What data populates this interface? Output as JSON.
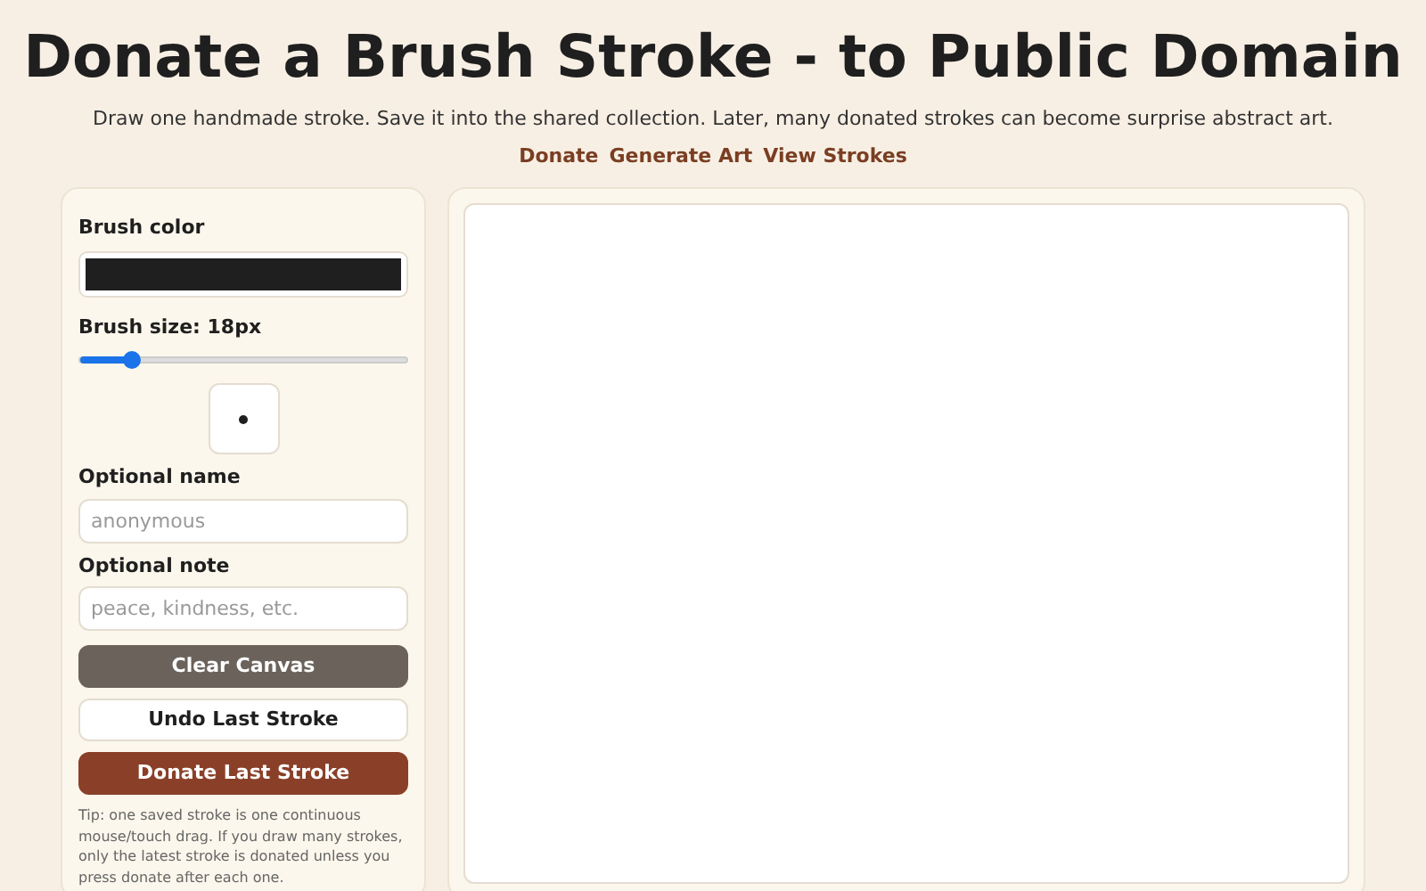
{
  "header": {
    "title": "Donate a Brush Stroke - to Public Domain",
    "subtitle": "Draw one handmade stroke. Save it into the shared collection. Later, many donated strokes can become surprise abstract art."
  },
  "nav": [
    "Donate",
    "Generate Art",
    "View Strokes"
  ],
  "controls": {
    "color_label": "Brush color",
    "color": "#1f1f1f",
    "size_label": "Brush size: 18px",
    "size": {
      "level": 0.16
    },
    "name": {
      "label": "Optional name",
      "placeholder": "anonymous"
    },
    "note": {
      "label": "Optional note",
      "placeholder": "peace, kindness, etc."
    },
    "buttons": [
      {
        "label": "Clear Canvas",
        "kind": "secondary"
      },
      {
        "label": "Undo Last Stroke",
        "kind": "outline"
      },
      {
        "label": "Donate Last Stroke",
        "kind": "primary"
      }
    ],
    "tip": "Tip: one saved stroke is one continuous mouse/touch drag. If you draw many strokes, only the latest stroke is donated unless you press donate after each one."
  }
}
